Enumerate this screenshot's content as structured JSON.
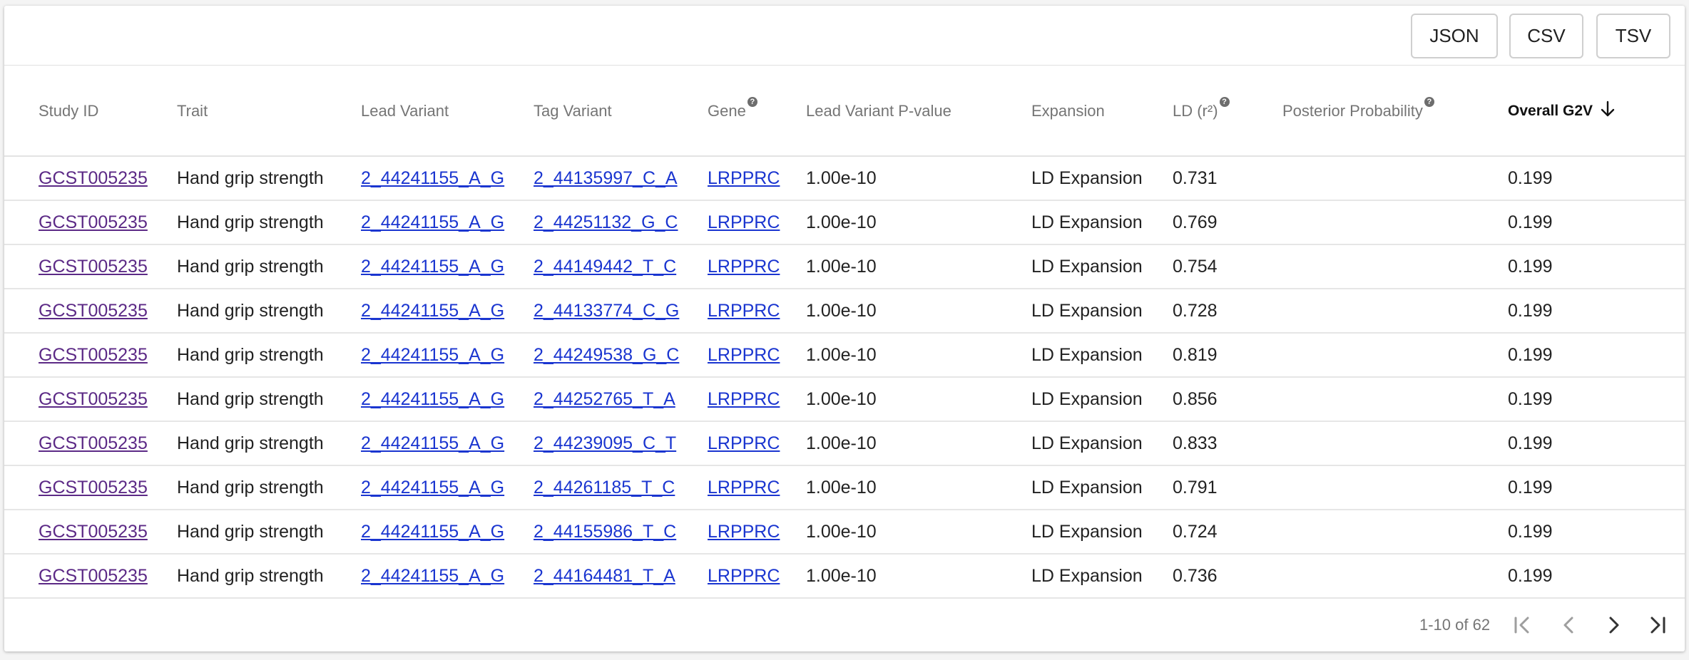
{
  "toolbar": {
    "json_label": "JSON",
    "csv_label": "CSV",
    "tsv_label": "TSV"
  },
  "headers": {
    "study_id": "Study ID",
    "trait": "Trait",
    "lead_variant": "Lead Variant",
    "tag_variant": "Tag Variant",
    "gene": "Gene",
    "lead_pvalue": "Lead Variant P-value",
    "expansion": "Expansion",
    "ld": "LD (r²)",
    "posterior": "Posterior Probability",
    "overall_g2v": "Overall G2V"
  },
  "help_glyph": "?",
  "rows": [
    {
      "study": "GCST005235",
      "trait": "Hand grip strength",
      "lead": "2_44241155_A_G",
      "tag": "2_44135997_C_A",
      "gene": "LRPPRC",
      "pval": "1.00e-10",
      "expansion": "LD Expansion",
      "ld": "0.731",
      "posterior": "",
      "g2v": "0.199"
    },
    {
      "study": "GCST005235",
      "trait": "Hand grip strength",
      "lead": "2_44241155_A_G",
      "tag": "2_44251132_G_C",
      "gene": "LRPPRC",
      "pval": "1.00e-10",
      "expansion": "LD Expansion",
      "ld": "0.769",
      "posterior": "",
      "g2v": "0.199"
    },
    {
      "study": "GCST005235",
      "trait": "Hand grip strength",
      "lead": "2_44241155_A_G",
      "tag": "2_44149442_T_C",
      "gene": "LRPPRC",
      "pval": "1.00e-10",
      "expansion": "LD Expansion",
      "ld": "0.754",
      "posterior": "",
      "g2v": "0.199"
    },
    {
      "study": "GCST005235",
      "trait": "Hand grip strength",
      "lead": "2_44241155_A_G",
      "tag": "2_44133774_C_G",
      "gene": "LRPPRC",
      "pval": "1.00e-10",
      "expansion": "LD Expansion",
      "ld": "0.728",
      "posterior": "",
      "g2v": "0.199"
    },
    {
      "study": "GCST005235",
      "trait": "Hand grip strength",
      "lead": "2_44241155_A_G",
      "tag": "2_44249538_G_C",
      "gene": "LRPPRC",
      "pval": "1.00e-10",
      "expansion": "LD Expansion",
      "ld": "0.819",
      "posterior": "",
      "g2v": "0.199"
    },
    {
      "study": "GCST005235",
      "trait": "Hand grip strength",
      "lead": "2_44241155_A_G",
      "tag": "2_44252765_T_A",
      "gene": "LRPPRC",
      "pval": "1.00e-10",
      "expansion": "LD Expansion",
      "ld": "0.856",
      "posterior": "",
      "g2v": "0.199"
    },
    {
      "study": "GCST005235",
      "trait": "Hand grip strength",
      "lead": "2_44241155_A_G",
      "tag": "2_44239095_C_T",
      "gene": "LRPPRC",
      "pval": "1.00e-10",
      "expansion": "LD Expansion",
      "ld": "0.833",
      "posterior": "",
      "g2v": "0.199"
    },
    {
      "study": "GCST005235",
      "trait": "Hand grip strength",
      "lead": "2_44241155_A_G",
      "tag": "2_44261185_T_C",
      "gene": "LRPPRC",
      "pval": "1.00e-10",
      "expansion": "LD Expansion",
      "ld": "0.791",
      "posterior": "",
      "g2v": "0.199"
    },
    {
      "study": "GCST005235",
      "trait": "Hand grip strength",
      "lead": "2_44241155_A_G",
      "tag": "2_44155986_T_C",
      "gene": "LRPPRC",
      "pval": "1.00e-10",
      "expansion": "LD Expansion",
      "ld": "0.724",
      "posterior": "",
      "g2v": "0.199"
    },
    {
      "study": "GCST005235",
      "trait": "Hand grip strength",
      "lead": "2_44241155_A_G",
      "tag": "2_44164481_T_A",
      "gene": "LRPPRC",
      "pval": "1.00e-10",
      "expansion": "LD Expansion",
      "ld": "0.736",
      "posterior": "",
      "g2v": "0.199"
    }
  ],
  "pagination": {
    "range_text": "1-10 of 62"
  },
  "colors": {
    "link": "#1a35d0",
    "visited_link": "#5c2a86",
    "header_text": "#757575",
    "divider": "#e6e6e6"
  },
  "icons": {
    "sort": "arrow-down-icon",
    "first": "first-page-icon",
    "prev": "chevron-left-icon",
    "next": "chevron-right-icon",
    "last": "last-page-icon"
  }
}
